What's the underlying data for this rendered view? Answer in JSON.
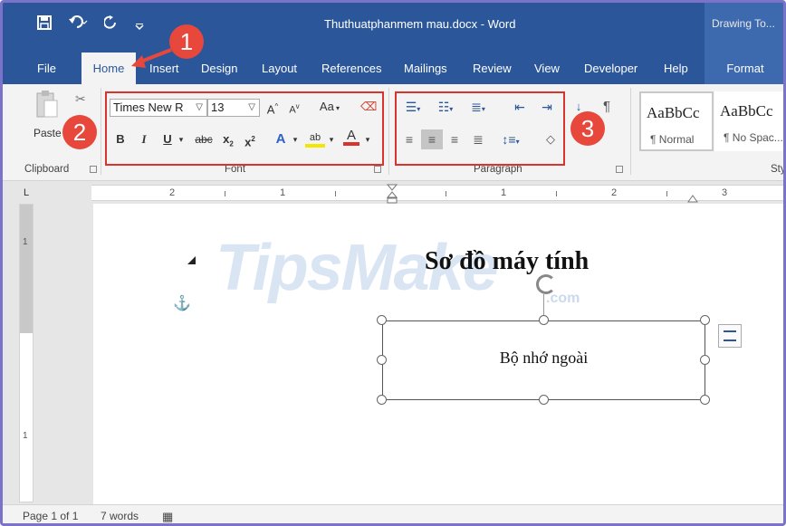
{
  "window": {
    "title": "Thuthuatphanmem mau.docx  -  Word",
    "context_tab_group": "Drawing To..."
  },
  "qat": {
    "save_icon": "save-icon",
    "undo_icon": "undo-icon",
    "redo_icon": "redo-icon",
    "customize_icon": "chevron-down-icon"
  },
  "tabs": [
    {
      "label": "File"
    },
    {
      "label": "Home",
      "active": true
    },
    {
      "label": "Insert"
    },
    {
      "label": "Design"
    },
    {
      "label": "Layout"
    },
    {
      "label": "References"
    },
    {
      "label": "Mailings"
    },
    {
      "label": "Review"
    },
    {
      "label": "View"
    },
    {
      "label": "Developer"
    },
    {
      "label": "Help"
    },
    {
      "label": "Format"
    }
  ],
  "ribbon": {
    "clipboard": {
      "paste_label": "Paste",
      "group_label": "Clipboard"
    },
    "font": {
      "font_name": "Times New R",
      "font_size": "13",
      "grow_label": "A",
      "shrink_label": "A",
      "case_label": "Aa",
      "bold": "B",
      "italic": "I",
      "underline": "U",
      "strike": "abc",
      "subscript": "x",
      "superscript": "x",
      "script_mark": "2",
      "effects_label": "A",
      "highlight_label": "ab",
      "color_label": "A",
      "group_label": "Font"
    },
    "paragraph": {
      "pilcrow": "¶",
      "group_label": "Paragraph"
    },
    "styles": {
      "items": [
        {
          "sample": "AaBbCc",
          "name": "¶ Normal"
        },
        {
          "sample": "AaBbCc",
          "name": "¶ No Spac..."
        }
      ],
      "group_label": "Sty"
    }
  },
  "callouts": [
    "1",
    "2",
    "3"
  ],
  "ruler": {
    "tab_selector": "L",
    "numbers": [
      "2",
      "1",
      "1",
      "2",
      "3"
    ],
    "vertical_numbers": [
      "1",
      "1"
    ]
  },
  "document": {
    "watermark": "TipsMake",
    "watermark_suffix": ".com",
    "heading": "Sơ đồ máy tính",
    "textbox_text": "Bộ nhớ ngoài"
  },
  "statusbar": {
    "page": "Page 1 of 1",
    "words": "7 words"
  },
  "colors": {
    "word_blue": "#2b579a",
    "callout_red": "#e8473b",
    "highlight_box": "#d9342b"
  }
}
